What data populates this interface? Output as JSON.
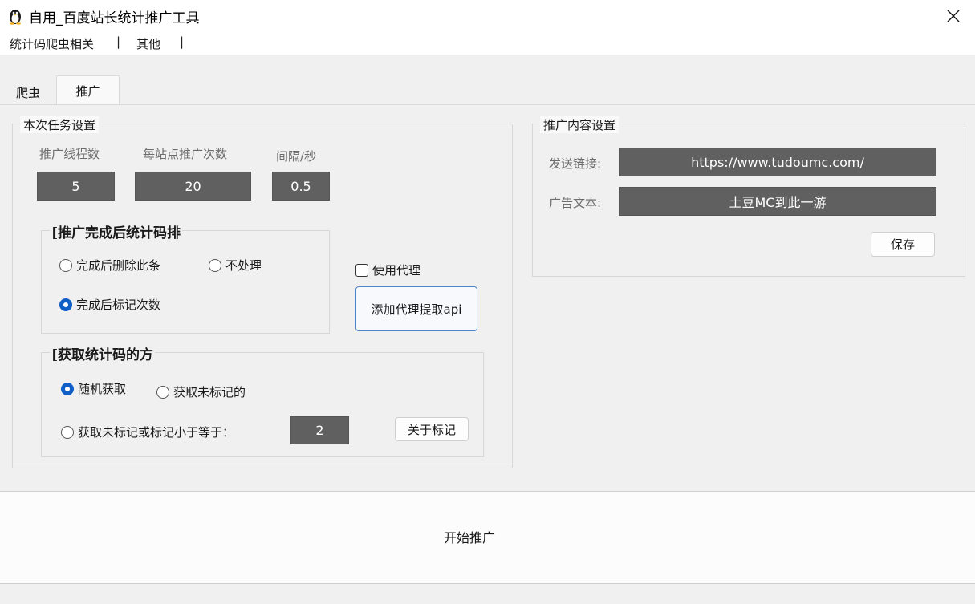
{
  "window": {
    "title": "自用_百度站长统计推广工具",
    "icon": "penguin-icon"
  },
  "menu": {
    "items": [
      "统计码爬虫相关",
      "其他"
    ],
    "separator": "|"
  },
  "tabs": [
    {
      "label": "爬虫",
      "active": false
    },
    {
      "label": "推广",
      "active": true
    }
  ],
  "task_settings": {
    "title": "本次任务设置",
    "threads_label": "推广线程数",
    "threads_value": "5",
    "per_site_label": "每站点推广次数",
    "per_site_value": "20",
    "interval_label": "间隔/秒",
    "interval_value": "0.5"
  },
  "after_promo": {
    "title": "[推广完成后统计码排",
    "options": [
      {
        "label": "完成后删除此条",
        "checked": false
      },
      {
        "label": "不处理",
        "checked": false
      },
      {
        "label": "完成后标记次数",
        "checked": true
      }
    ]
  },
  "proxy": {
    "checkbox_label": "使用代理",
    "checked": false,
    "api_button": "添加代理提取api"
  },
  "fetch_method": {
    "title": "[获取统计码的方",
    "options": [
      {
        "label": "随机获取",
        "checked": true
      },
      {
        "label": "获取未标记的",
        "checked": false
      },
      {
        "label": "获取未标记或标记小于等于：",
        "checked": false
      }
    ],
    "threshold_value": "2",
    "about_button": "关于标记"
  },
  "promo_content": {
    "title": "推广内容设置",
    "link_label": "发送链接:",
    "link_value": "https://www.tudoumc.com/",
    "ad_label": "广告文本:",
    "ad_value": "土豆MC到此一游",
    "save_button": "保存"
  },
  "start_button": "开始推广",
  "colors": {
    "accent": "#0f5fc6",
    "field_bg": "#606060",
    "window_bg": "#f0f0f0"
  }
}
